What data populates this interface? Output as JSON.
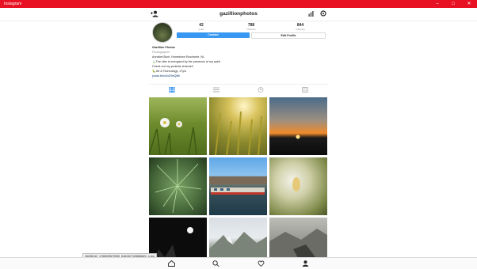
{
  "window": {
    "title": "Instagram",
    "minimize_icon": "minimize-icon",
    "maximize_icon": "maximize-icon",
    "close_icon": "close-icon"
  },
  "header": {
    "username": "gazillionphotos",
    "left_icon": "add-person-icon",
    "right_icons": [
      "insights-icon",
      "settings-icon"
    ]
  },
  "profile": {
    "stats": [
      {
        "value": "42",
        "label": "posts"
      },
      {
        "value": "788",
        "label": "followers"
      },
      {
        "value": "844",
        "label": "following"
      }
    ],
    "contact_label": "Contact",
    "edit_label": "Edit Profile",
    "display_name": "Gazillion Photos",
    "category": "Photographer",
    "bio_lines": [
      "Annabel Bunt. Hometown Enschede. NL",
      "🍃The vibe is energized by the presence of my spirit",
      "Check out my youtube channel!",
      "🐛Art & Technology. 17y/o"
    ],
    "link": "youtu.be/c0xD9xQ5ih"
  },
  "tabs": [
    "grid-icon",
    "list-icon",
    "tagged-icon",
    "saved-icon"
  ],
  "status_url": "16298142_1766929670055_5181927105856824_n.jpg",
  "bottom_nav": [
    "home-icon",
    "search-icon",
    "heart-icon",
    "profile-icon"
  ],
  "colors": {
    "titlebar": "#e81123",
    "accent": "#3897f0"
  }
}
